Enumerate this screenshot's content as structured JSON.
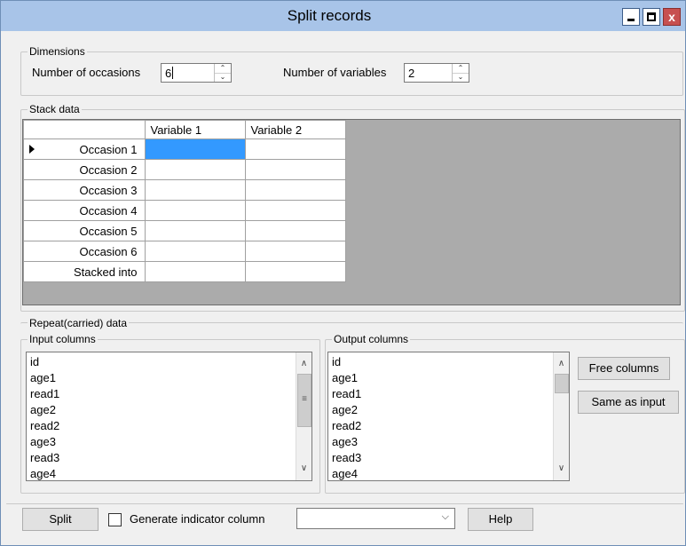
{
  "window": {
    "title": "Split records"
  },
  "titlebar": {
    "close_glyph": "x"
  },
  "dimensions": {
    "legend": "Dimensions",
    "occasions_label": "Number of occasions",
    "occasions_value": "6",
    "variables_label": "Number of variables",
    "variables_value": "2"
  },
  "stack": {
    "legend": "Stack data",
    "columns": [
      "Variable  1",
      "Variable  2"
    ],
    "rows": [
      "Occasion 1",
      "Occasion 2",
      "Occasion 3",
      "Occasion 4",
      "Occasion 5",
      "Occasion 6",
      "Stacked into"
    ],
    "selected_row": 0,
    "selected_col": 0
  },
  "repeat": {
    "legend": "Repeat(carried) data",
    "input_legend": "Input columns",
    "output_legend": "Output columns",
    "input_items": [
      "id",
      "age1",
      "read1",
      "age2",
      "read2",
      "age3",
      "read3",
      "age4"
    ],
    "output_items": [
      "id",
      "age1",
      "read1",
      "age2",
      "read2",
      "age3",
      "read3",
      "age4"
    ],
    "free_columns_label": "Free columns",
    "same_as_input_label": "Same as input"
  },
  "footer": {
    "split_label": "Split",
    "indicator_label": "Generate indicator column",
    "indicator_checked": false,
    "combo_value": "",
    "help_label": "Help"
  },
  "icons": {
    "spin_up": "up-arrow-icon",
    "spin_down": "down-arrow-icon",
    "scroll_up": "scroll-up-icon",
    "scroll_down": "scroll-down-icon",
    "row_pointer": "row-pointer-icon"
  }
}
